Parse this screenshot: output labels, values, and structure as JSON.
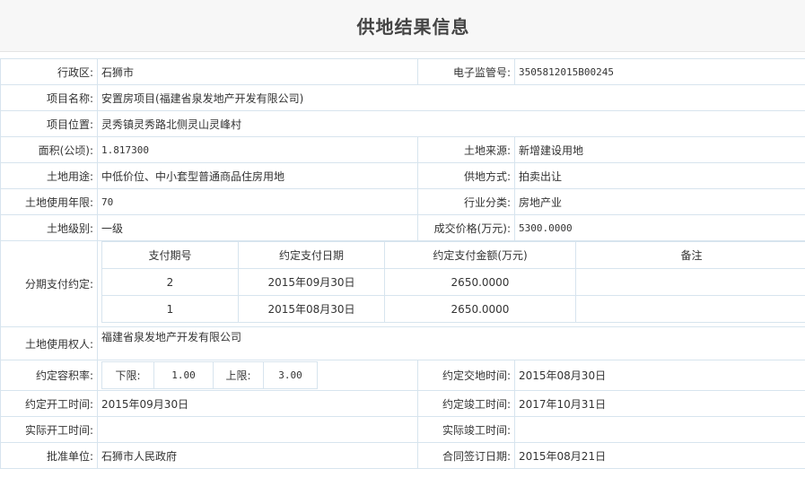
{
  "page": {
    "title": "供地结果信息"
  },
  "rows": {
    "district_label": "行政区:",
    "district_value": "石狮市",
    "supervision_label": "电子监管号:",
    "supervision_value": "3505812015B00245",
    "project_name_label": "项目名称:",
    "project_name_value": "安置房项目(福建省泉发地产开发有限公司)",
    "project_location_label": "项目位置:",
    "project_location_value": "灵秀镇灵秀路北侧灵山灵峰村",
    "area_label": "面积(公顷):",
    "area_value": "1.817300",
    "land_source_label": "土地来源:",
    "land_source_value": "新增建设用地",
    "land_use_label": "土地用途:",
    "land_use_value": "中低价位、中小套型普通商品住房用地",
    "supply_method_label": "供地方式:",
    "supply_method_value": "拍卖出让",
    "use_years_label": "土地使用年限:",
    "use_years_value": "70",
    "industry_label": "行业分类:",
    "industry_value": "房地产业",
    "land_grade_label": "土地级别:",
    "land_grade_value": "一级",
    "price_label": "成交价格(万元):",
    "price_value": "5300.0000",
    "installment_label": "分期支付约定:",
    "holder_label": "土地使用权人:",
    "holder_value": "福建省泉发地产开发有限公司",
    "far_label": "约定容积率:",
    "delivery_label": "约定交地时间:",
    "delivery_value": "2015年08月30日",
    "start_label": "约定开工时间:",
    "start_value": "2015年09月30日",
    "finish_label": "约定竣工时间:",
    "finish_value": "2017年10月31日",
    "actual_start_label": "实际开工时间:",
    "actual_start_value": "",
    "actual_finish_label": "实际竣工时间:",
    "actual_finish_value": "",
    "approver_label": "批准单位:",
    "approver_value": "石狮市人民政府",
    "contract_label": "合同签订日期:",
    "contract_value": "2015年08月21日"
  },
  "installments": {
    "headers": [
      "支付期号",
      "约定支付日期",
      "约定支付金额(万元)",
      "备注"
    ],
    "rows": [
      {
        "period": "2",
        "date": "2015年09月30日",
        "amount": "2650.0000",
        "note": ""
      },
      {
        "period": "1",
        "date": "2015年08月30日",
        "amount": "2650.0000",
        "note": ""
      }
    ]
  },
  "far": {
    "lower_label": "下限:",
    "lower_value": "1.00",
    "upper_label": "上限:",
    "upper_value": "3.00"
  }
}
